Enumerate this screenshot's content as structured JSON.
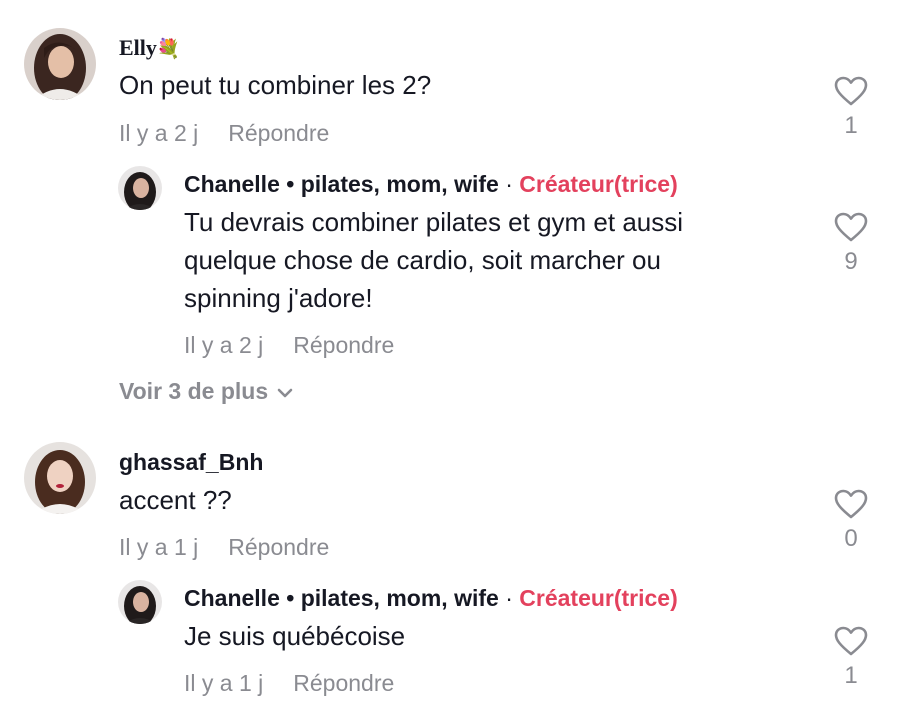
{
  "comments": [
    {
      "username": "Elly",
      "emoji": "💐",
      "text": "On peut tu combiner les 2?",
      "time": "Il y a 2 j",
      "reply_label": "Répondre",
      "likes": "1",
      "replies": [
        {
          "username": "Chanelle • pilates, mom, wife",
          "separator": "·",
          "creator_tag": "Créateur(trice)",
          "lines": [
            "Tu devrais combiner pilates et gym et aussi",
            "quelque chose de cardio, soit marcher ou",
            "spinning j'adore!"
          ],
          "time": "Il y a 2 j",
          "reply_label": "Répondre",
          "likes": "9"
        }
      ],
      "more_label": "Voir 3 de plus"
    },
    {
      "username": "ghassaf_Bnh",
      "text": "accent ??",
      "time": "Il y a 1 j",
      "reply_label": "Répondre",
      "likes": "0",
      "replies": [
        {
          "username": "Chanelle • pilates, mom, wife",
          "separator": "·",
          "creator_tag": "Créateur(trice)",
          "lines": [
            "Je suis québécoise"
          ],
          "time": "Il y a 1 j",
          "reply_label": "Répondre",
          "likes": "1"
        }
      ]
    }
  ],
  "colors": {
    "text": "#161823",
    "muted": "#8a8b91",
    "creator_accent": "#e3415d"
  },
  "icons": {
    "like": "heart-outline-icon",
    "expand": "chevron-down-icon"
  }
}
